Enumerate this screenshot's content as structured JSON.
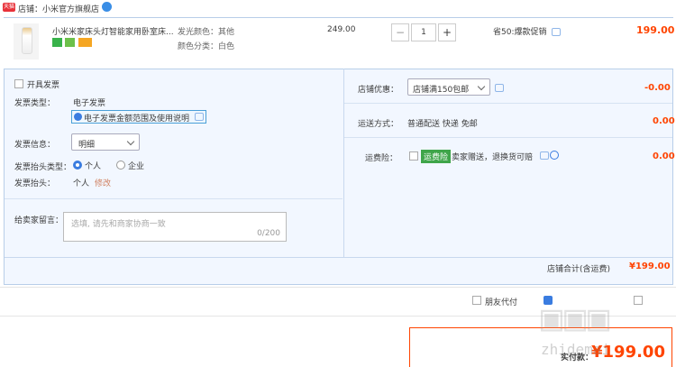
{
  "shop": {
    "badge": "天猫",
    "label": "店铺：",
    "name": "小米官方旗舰店"
  },
  "item": {
    "title": "小米米家床头灯智能家用卧室床...",
    "attr1_label": "发光颜色：",
    "attr1_value": "其他",
    "attr2_label": "颜色分类：",
    "attr2_value": "白色",
    "price": "249.00",
    "quantity": "1",
    "minus": "−",
    "plus": "+",
    "promo": "省50:爆款促销",
    "subtotal": "199.00"
  },
  "invoice": {
    "open_label": "开具发票",
    "type_label": "发票类型：",
    "type_value": "电子发票",
    "info_link": "电子发票金额范围及使用说明",
    "content_label": "发票信息：",
    "content_value": "明细",
    "title_type_label": "发票抬头类型：",
    "personal": "个人",
    "company": "企业",
    "title_label": "发票抬头：",
    "title_value": "个人",
    "edit": "修改"
  },
  "message": {
    "label": "给卖家留言：",
    "placeholder": "选填, 请先和商家协商一致",
    "counter": "0/200"
  },
  "discount": {
    "label": "店铺优惠：",
    "value": "店铺满150包邮",
    "amount": "-0.00"
  },
  "shipping": {
    "label": "运送方式：",
    "value": "普通配送 快递 免邮",
    "amount": "0.00"
  },
  "insurance": {
    "label": "运费险：",
    "badge": "运费险",
    "desc": "卖家赠送，退换货可赔",
    "amount": "0.00"
  },
  "total": {
    "label": "店铺合计(含运费)",
    "amount": "¥199.00"
  },
  "footer": {
    "friend_pay": "朋友代付",
    "pay_label": "实付款：",
    "pay_amount": "¥199.00"
  },
  "watermark": "zhidemai",
  "colors": {
    "accent": "#ff4400",
    "panel_bg": "#f2f7ff",
    "border": "#b8cee9",
    "link": "#3a7ce0"
  }
}
